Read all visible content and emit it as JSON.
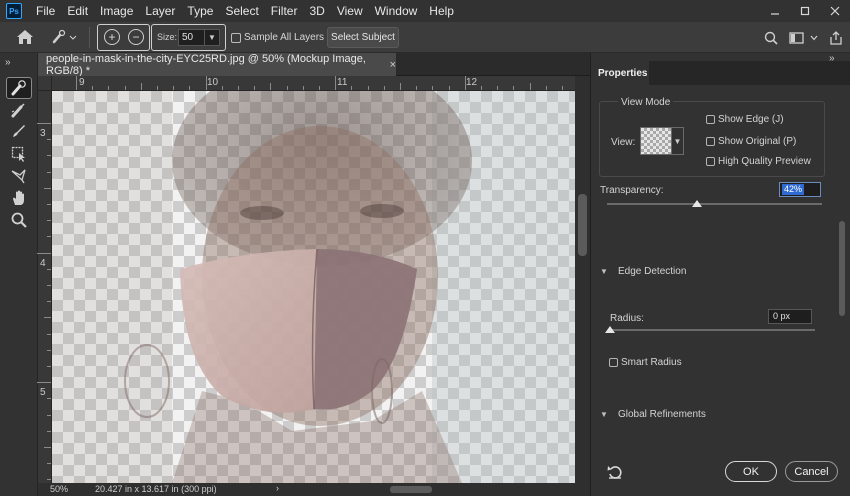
{
  "app": {
    "logo": "Ps",
    "menu": [
      "File",
      "Edit",
      "Image",
      "Layer",
      "Type",
      "Select",
      "Filter",
      "3D",
      "View",
      "Window",
      "Help"
    ],
    "window_controls": [
      "minimize-icon",
      "restore-icon",
      "close-icon"
    ]
  },
  "options": {
    "size_label": "Size:",
    "size_value": "50",
    "sample_all_layers_label": "Sample All Layers",
    "sample_all_layers_checked": false,
    "select_subject_label": "Select Subject",
    "right_icons": [
      "search-icon",
      "workspace-icon",
      "share-icon"
    ]
  },
  "tools": {
    "header": "»",
    "items": [
      "quick-selection-brush-icon",
      "refine-edge-brush-icon",
      "brush-icon",
      "object-selection-icon",
      "lasso-icon",
      "hand-icon",
      "zoom-icon"
    ],
    "active": "quick-selection-brush-icon"
  },
  "document": {
    "tab_title": "people-in-mask-in-the-city-EYC25RD.jpg @ 50% (Mockup Image, RGB/8) *",
    "tab_close": "×",
    "ruler_top_labels": [
      "9",
      "10",
      "11",
      "12"
    ],
    "ruler_left_labels": [
      "3",
      "4",
      "5"
    ],
    "status_zoom": "50%",
    "status_info": "20.427 in x 13.617 in (300 ppi)",
    "status_arrow": "›"
  },
  "properties": {
    "tab_label": "Properties",
    "panel_menu": "»",
    "view_mode_title": "View Mode",
    "view_label": "View:",
    "show_edge_label": "Show Edge (J)",
    "show_edge_checked": false,
    "show_original_label": "Show Original (P)",
    "show_original_checked": false,
    "high_quality_label": "High Quality Preview",
    "high_quality_checked": false,
    "transparency_label": "Transparency:",
    "transparency_value": "42%",
    "transparency_fraction": 0.42,
    "edge_detection_title": "Edge Detection",
    "radius_label": "Radius:",
    "radius_value": "0 px",
    "radius_fraction": 0,
    "smart_radius_label": "Smart Radius",
    "smart_radius_checked": false,
    "global_refinements_title": "Global Refinements",
    "ok_label": "OK",
    "cancel_label": "Cancel"
  }
}
